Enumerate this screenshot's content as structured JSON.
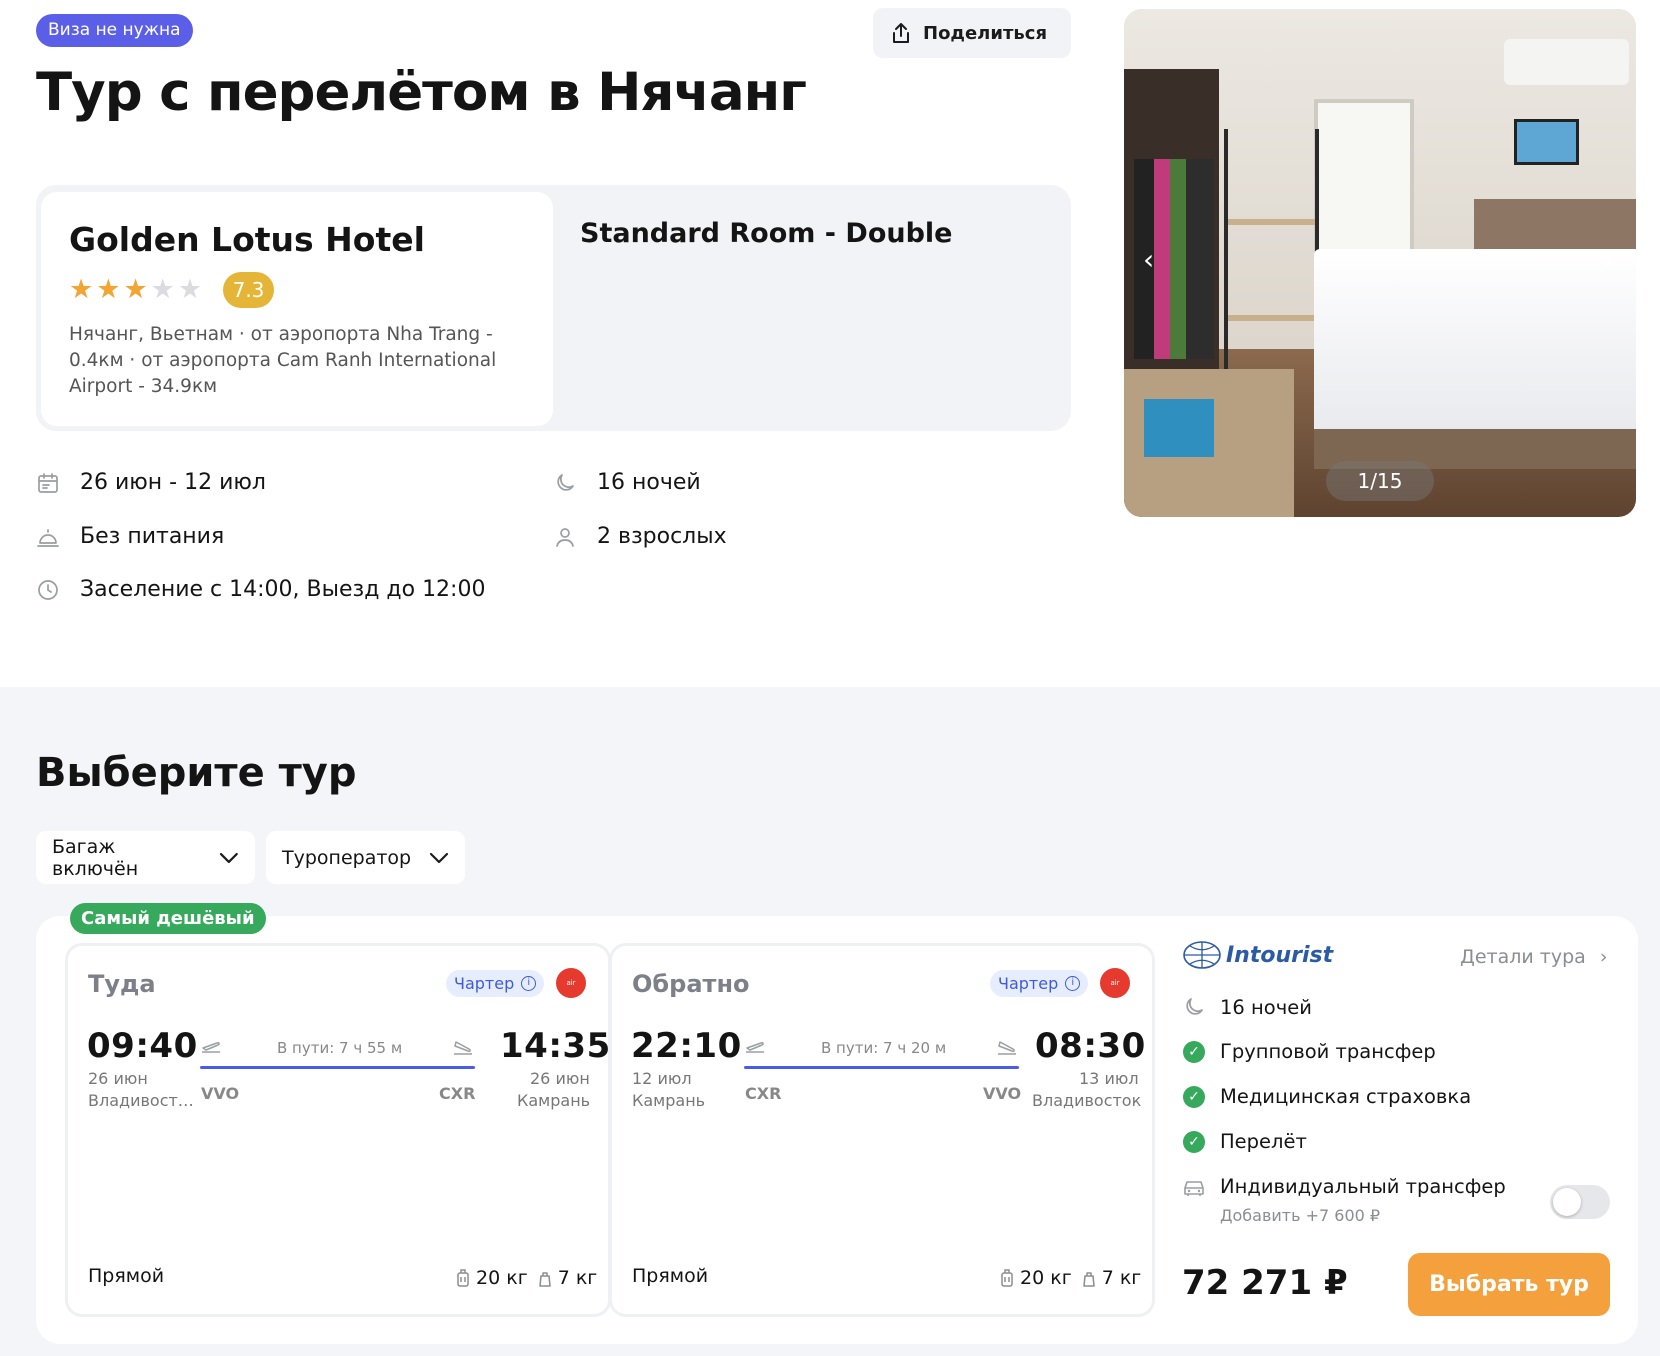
{
  "header": {
    "visa_badge": "Виза не нужна",
    "share_label": "Поделиться",
    "title": "Тур с перелётом в Нячанг"
  },
  "hotel": {
    "name": "Golden Lotus Hotel",
    "stars": 3,
    "stars_max": 5,
    "rating": "7.3",
    "location": "Нячанг, Вьетнам · от аэропорта Nha Trang - 0.4км · от аэропорта Cam Ranh International Airport - 34.9км",
    "room": "Standard Room - Double"
  },
  "facts": {
    "dates": "26 июн - 12 июл",
    "nights": "16 ночей",
    "meals": "Без питания",
    "guests": "2 взрослых",
    "checkin": "Заселение с 14:00, Выезд до 12:00"
  },
  "gallery": {
    "counter": "1/15"
  },
  "choose": {
    "title": "Выберите тур",
    "filters": [
      "Багаж включён",
      "Туроператор"
    ],
    "badge": "Самый дешёвый"
  },
  "legs": [
    {
      "title": "Туда",
      "charter": "Чартер",
      "dep_time": "09:40",
      "dep_date": "26 июн",
      "dep_city": "Владивост…",
      "dep_code": "VVO",
      "duration": "В пути: 7 ч 55 м",
      "arr_time": "14:35",
      "arr_date": "26 июн",
      "arr_city": "Камрань",
      "arr_code": "CXR",
      "type": "Прямой",
      "baggage": "20 кг",
      "hand": "7 кг"
    },
    {
      "title": "Обратно",
      "charter": "Чартер",
      "dep_time": "22:10",
      "dep_date": "12 июл",
      "dep_city": "Камрань",
      "dep_code": "CXR",
      "duration": "В пути: 7 ч 20 м",
      "arr_time": "08:30",
      "arr_date": "13 июл",
      "arr_city": "Владивосток",
      "arr_code": "VVO",
      "type": "Прямой",
      "baggage": "20 кг",
      "hand": "7 кг"
    }
  ],
  "summary": {
    "operator": "Intourist",
    "details_link": "Детали тура",
    "nights": "16 ночей",
    "included": [
      "Групповой трансфер",
      "Медицинская страховка",
      "Перелёт"
    ],
    "addon_label": "Индивидуальный трансфер",
    "addon_sub": "Добавить +7 600 ₽",
    "addon_enabled": false,
    "price": "72 271 ₽",
    "select_label": "Выбрать тур"
  },
  "colors": {
    "accent_blue": "#5b5fe8",
    "rating": "#e4b536",
    "star": "#f2a533",
    "green": "#36a95c",
    "cta": "#f4a13d",
    "route": "#4a5ce6"
  }
}
